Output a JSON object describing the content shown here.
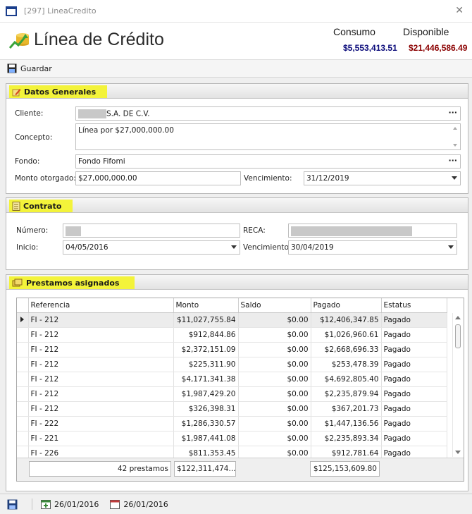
{
  "window": {
    "title": "[297] LineaCredito"
  },
  "header": {
    "title": "Línea de Crédito",
    "consumo_label": "Consumo",
    "consumo_value": "$5,553,413.51",
    "disponible_label": "Disponible",
    "disponible_value": "$21,446,586.49",
    "colors": {
      "consumo": "#0a0a7a",
      "disponible": "#8b0000"
    }
  },
  "toolbar": {
    "save_label": "Guardar",
    "save_icon": "floppy-disk-icon"
  },
  "datos_generales": {
    "title": "Datos Generales",
    "cliente_label": "Cliente:",
    "cliente_value": "S.A. DE C.V.",
    "concepto_label": "Concepto:",
    "concepto_value": "Línea por $27,000,000.00",
    "fondo_label": "Fondo:",
    "fondo_value": "Fondo Fifomi",
    "monto_label": "Monto otorgado:",
    "monto_value": "$27,000,000.00",
    "vencimiento_label": "Vencimiento:",
    "vencimiento_value": "31/12/2019",
    "ellipsis": "···"
  },
  "contrato": {
    "title": "Contrato",
    "numero_label": "Número:",
    "reca_label": "RECA:",
    "inicio_label": "Inicio:",
    "inicio_value": "04/05/2016",
    "vencimiento_label": "Vencimiento:",
    "vencimiento_value": "30/04/2019"
  },
  "prestamos": {
    "title": "Prestamos asignados",
    "columns": [
      "Referencia",
      "Monto",
      "Saldo",
      "Pagado",
      "Estatus"
    ],
    "rows": [
      [
        "FI - 212",
        "$11,027,755.84",
        "$0.00",
        "$12,406,347.85",
        "Pagado"
      ],
      [
        "FI - 212",
        "$912,844.86",
        "$0.00",
        "$1,026,960.61",
        "Pagado"
      ],
      [
        "FI - 212",
        "$2,372,151.09",
        "$0.00",
        "$2,668,696.33",
        "Pagado"
      ],
      [
        "FI - 212",
        "$225,311.90",
        "$0.00",
        "$253,478.39",
        "Pagado"
      ],
      [
        "FI - 212",
        "$4,171,341.38",
        "$0.00",
        "$4,692,805.40",
        "Pagado"
      ],
      [
        "FI - 212",
        "$1,987,429.20",
        "$0.00",
        "$2,235,879.94",
        "Pagado"
      ],
      [
        "FI - 212",
        "$326,398.31",
        "$0.00",
        "$367,201.73",
        "Pagado"
      ],
      [
        "FI - 222",
        "$1,286,330.57",
        "$0.00",
        "$1,447,136.56",
        "Pagado"
      ],
      [
        "FI - 221",
        "$1,987,441.08",
        "$0.00",
        "$2,235,893.34",
        "Pagado"
      ],
      [
        "FI - 226",
        "$811,353.45",
        "$0.00",
        "$912,781.64",
        "Pagado"
      ]
    ],
    "summary": {
      "count": "42 prestamos",
      "monto_total": "$122,311,474...",
      "pagado_total": "$125,153,609.80"
    }
  },
  "statusbar": {
    "date1": "26/01/2016",
    "date2": "26/01/2016"
  }
}
